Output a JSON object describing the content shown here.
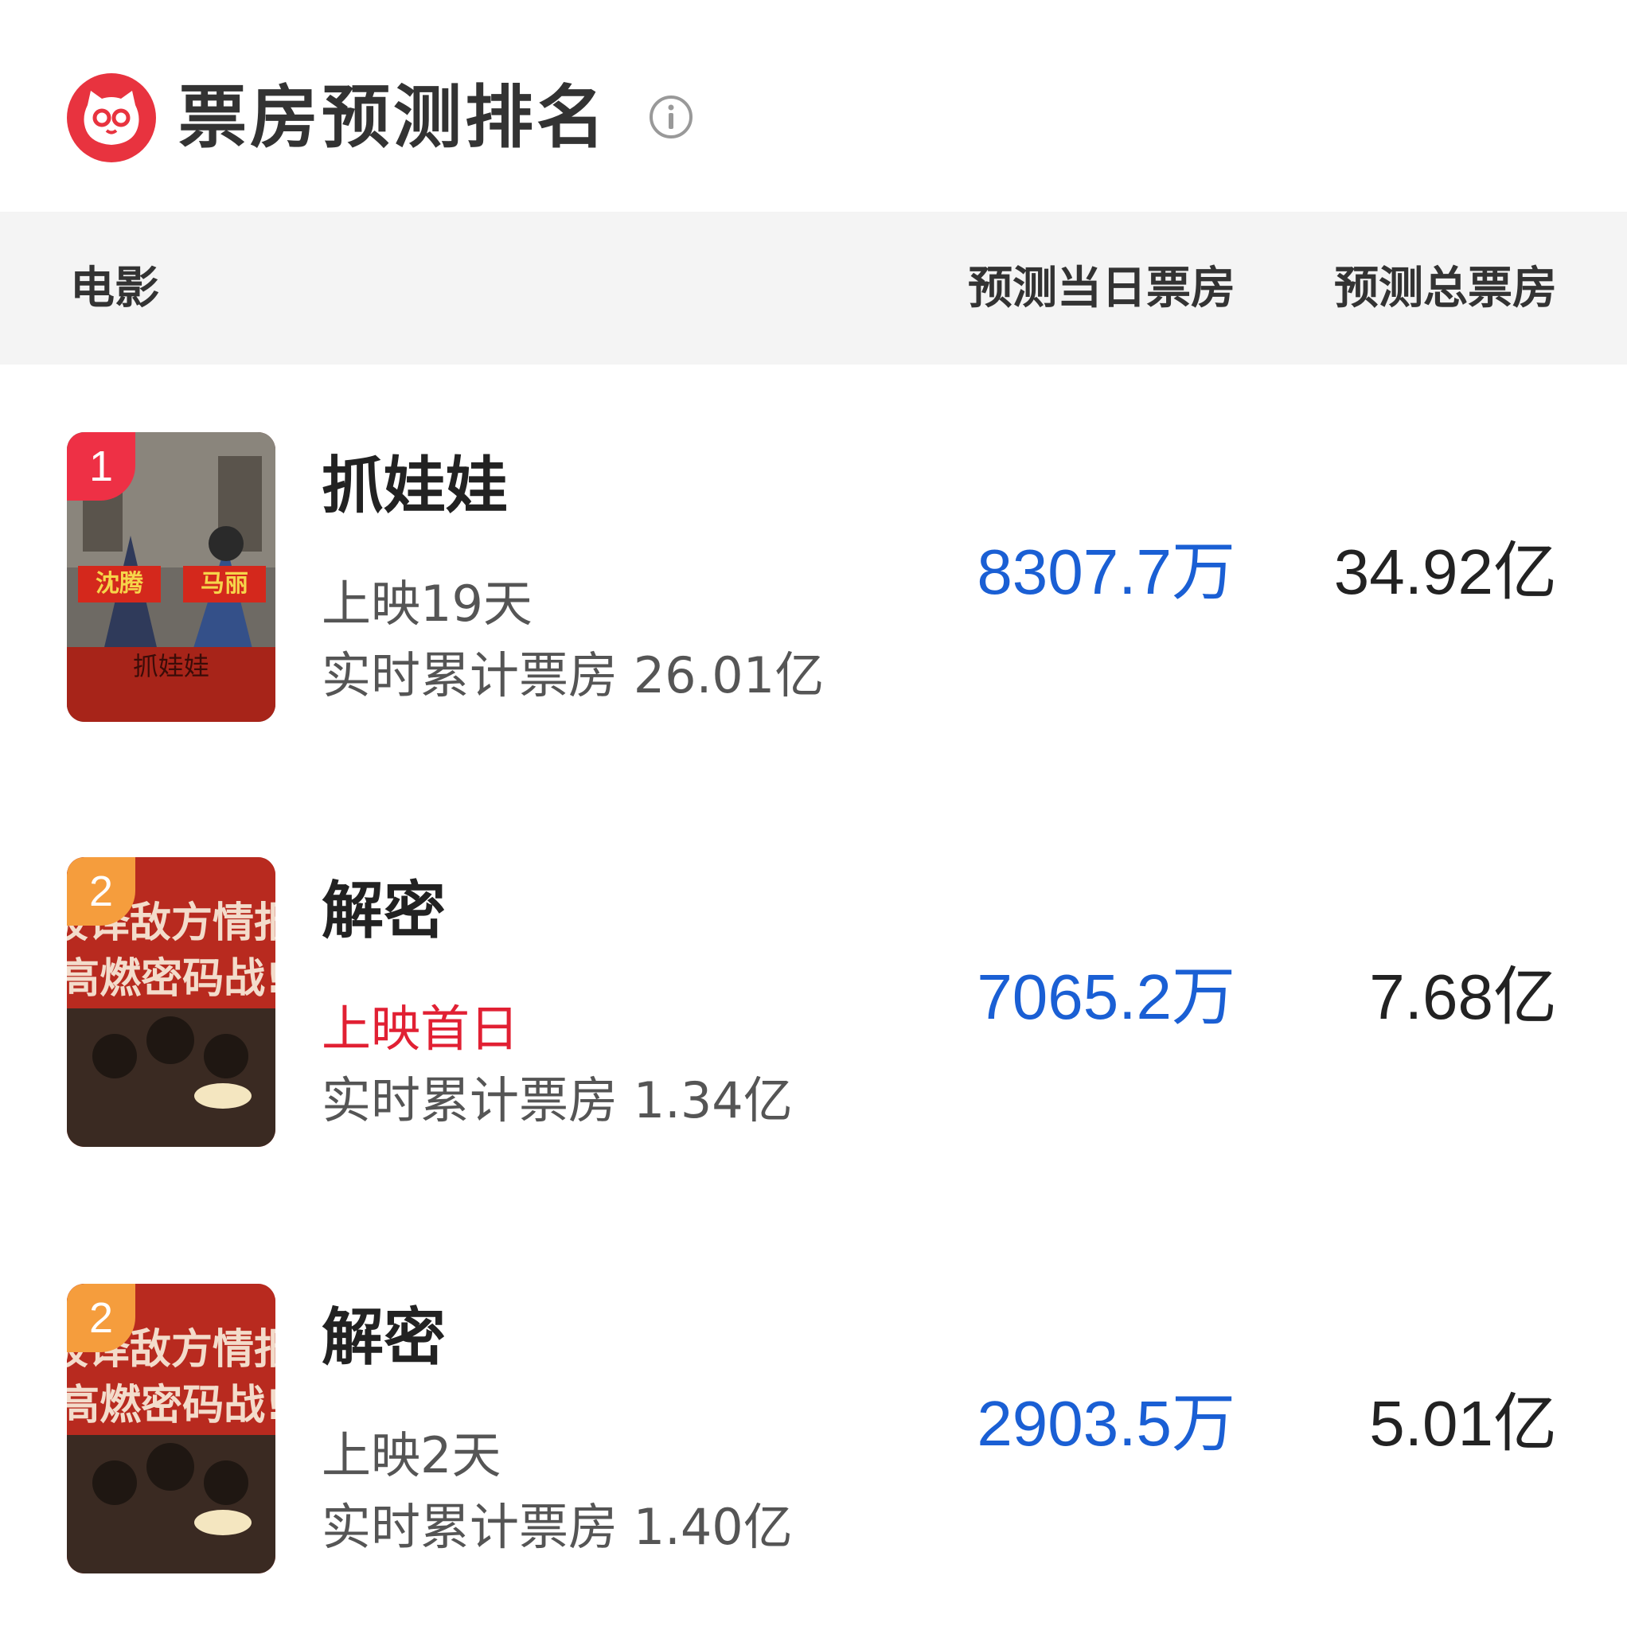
{
  "header": {
    "title": "票房预测排名",
    "logo_icon": "maoyan-cat-logo",
    "info_icon": "info-icon",
    "brand_color": "#e8333f"
  },
  "table_header": {
    "movie": "电影",
    "day_prediction": "预测当日票房",
    "total_prediction": "预测总票房"
  },
  "rows": [
    {
      "rank": "1",
      "rank_color": "#ee3045",
      "title": "抓娃娃",
      "release": "上映19天",
      "cumulative": "实时累计票房 26.01亿",
      "day_prediction": "8307.7万",
      "total_prediction": "34.92亿"
    },
    {
      "rank": "2",
      "rank_color": "#f59d3d",
      "title": "解密",
      "release": "上映首日",
      "release_highlight": true,
      "cumulative": "实时累计票房 1.34亿",
      "day_prediction": "7065.2万",
      "total_prediction": "7.68亿"
    },
    {
      "rank": "2",
      "rank_color": "#f59d3d",
      "title": "解密",
      "release": "上映2天",
      "cumulative": "实时累计票房 1.40亿",
      "day_prediction": "2903.5万",
      "total_prediction": "5.01亿"
    }
  ],
  "colors": {
    "day_prediction": "#1a5fd4",
    "release_highlight": "#e12033",
    "header_bg": "#f4f4f4"
  }
}
